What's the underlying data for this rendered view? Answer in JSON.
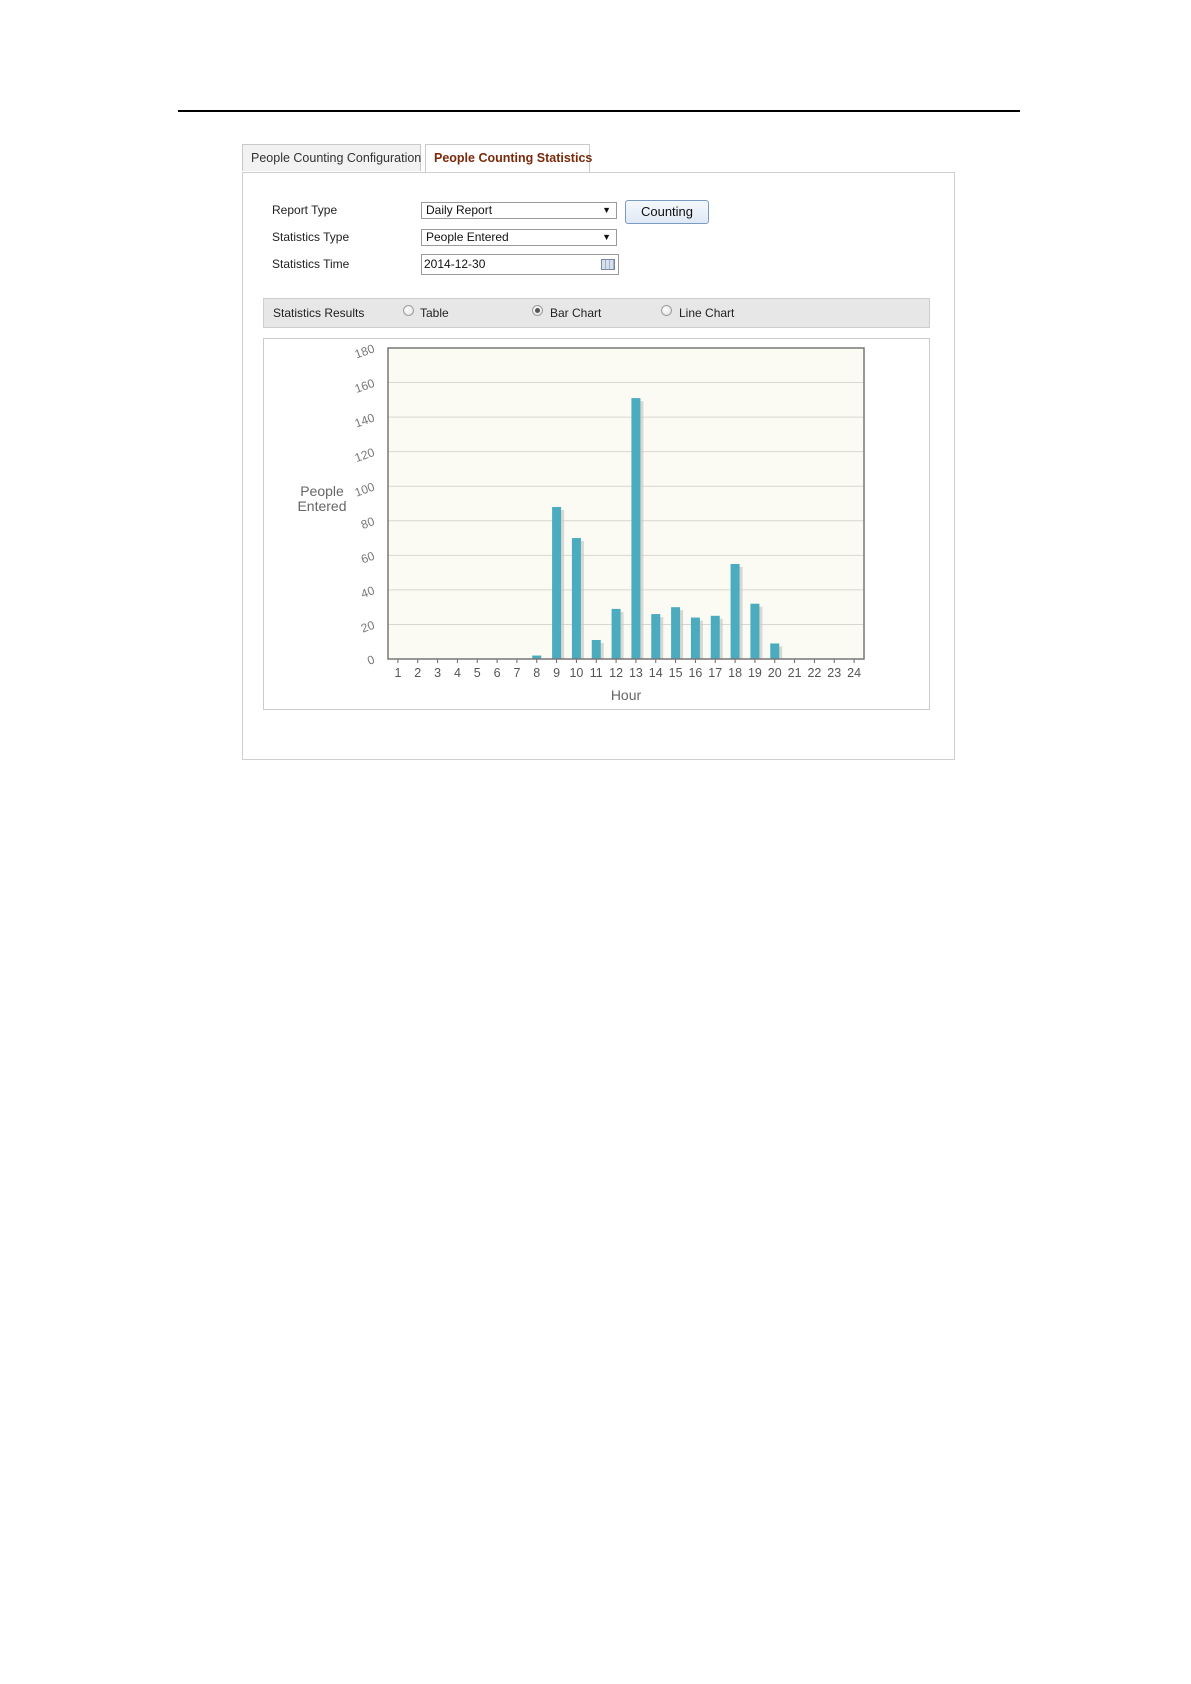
{
  "tabs": [
    {
      "label": "People Counting Configuration",
      "active": false
    },
    {
      "label": "People Counting Statistics",
      "active": true
    }
  ],
  "form": {
    "report_type": {
      "label": "Report Type",
      "value": "Daily Report"
    },
    "statistics_type": {
      "label": "Statistics Type",
      "value": "People Entered"
    },
    "statistics_time": {
      "label": "Statistics Time",
      "value": "2014-12-30"
    },
    "counting_button": "Counting"
  },
  "results": {
    "label": "Statistics Results",
    "options": [
      {
        "label": "Table",
        "checked": false
      },
      {
        "label": "Bar Chart",
        "checked": true
      },
      {
        "label": "Line Chart",
        "checked": false
      }
    ]
  },
  "icons": {
    "calendar": "calendar-icon",
    "dropdown": "chevron-down-icon"
  },
  "colors": {
    "bar": "#4bacc0",
    "plot_bg": "#fcfbf3",
    "active_tab": "#7a2a0a"
  },
  "chart_data": {
    "type": "bar",
    "xlabel": "Hour",
    "ylabel_lines": [
      "People",
      "Entered"
    ],
    "categories": [
      "1",
      "2",
      "3",
      "4",
      "5",
      "6",
      "7",
      "8",
      "9",
      "10",
      "11",
      "12",
      "13",
      "14",
      "15",
      "16",
      "17",
      "18",
      "19",
      "20",
      "21",
      "22",
      "23",
      "24"
    ],
    "values": [
      0,
      0,
      0,
      0,
      0,
      0,
      0,
      2,
      88,
      70,
      11,
      29,
      151,
      26,
      30,
      24,
      25,
      55,
      32,
      9,
      0,
      0,
      0,
      0
    ],
    "yticks": [
      "0",
      "20",
      "40",
      "60",
      "80",
      "100",
      "120",
      "140",
      "160",
      "180"
    ],
    "ylim": [
      0,
      180
    ],
    "grid": true
  }
}
